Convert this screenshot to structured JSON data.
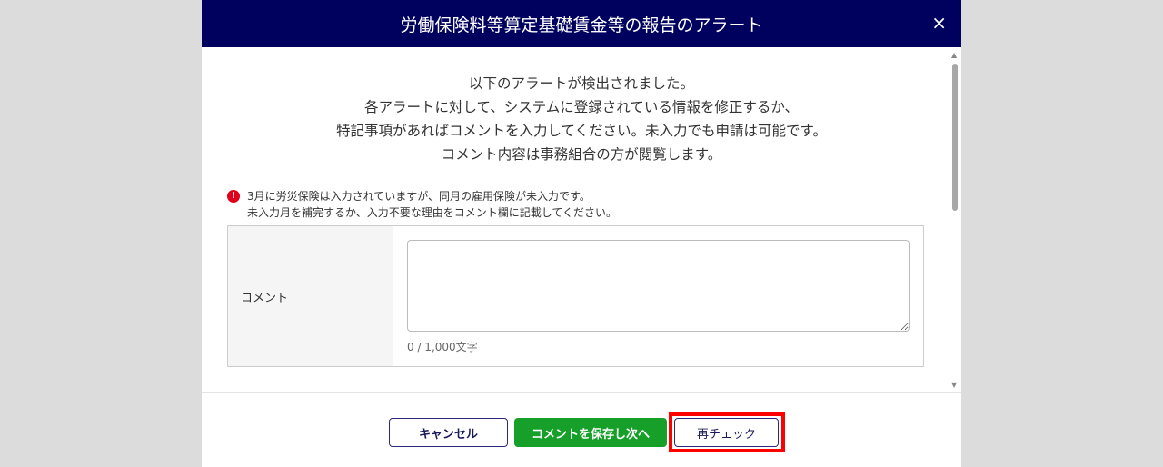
{
  "dialog": {
    "title": "労働保険料等算定基礎賃金等の報告のアラート",
    "close_icon": "×"
  },
  "intro": [
    "以下のアラートが検出されました。",
    "各アラートに対して、システムに登録されている情報を修正するか、",
    "特記事項があればコメントを入力してください。未入力でも申請は可能です。",
    "コメント内容は事務組合の方が閲覧します。"
  ],
  "alert": {
    "icon": "!",
    "lines": [
      "3月に労災保険は入力されていますが、同月の雇用保険が未入力です。",
      "未入力月を補完するか、入力不要な理由をコメント欄に記載してください。"
    ]
  },
  "comment": {
    "label": "コメント",
    "value": "",
    "counter": "0 / 1,000文字"
  },
  "buttons": {
    "cancel": "キャンセル",
    "save_next": "コメントを保存し次へ",
    "recheck": "再チェック"
  },
  "colors": {
    "header": "#00005e",
    "save": "#16a02a",
    "alert": "#e0001b",
    "highlight": "#ff0000"
  }
}
